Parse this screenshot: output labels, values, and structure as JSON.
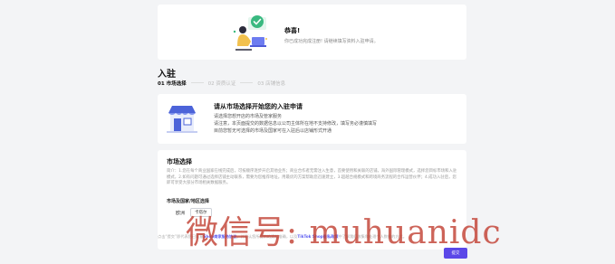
{
  "banner": {
    "title": "恭喜!",
    "subtitle": "你已成功完成注册! 请继续填写资料入驻申请。"
  },
  "page_title": "入驻",
  "steps": [
    {
      "label": "01 市场选择",
      "active": true
    },
    {
      "label": "02 资质认证",
      "active": false
    },
    {
      "label": "03 店铺信息",
      "active": false
    }
  ],
  "intro": {
    "heading": "请从市场选择开始您的入驻申请",
    "lines": [
      "请选择您想开店的市场及管家服务",
      "请注意，本页面提交的数据信息以公司主体所在地不支持修改，填写务必谨慎填写",
      "目前您暂无可选择的市场及国家可在入驻后以店铺形式开通"
    ]
  },
  "market": {
    "heading": "市场选择",
    "description": "简介：1.您在每个商业国家在线完成后，可按顺序逐步开启其他业务；商业合作者无需注入生意，首要使用和关联的店铺，海外国际管理模式，选择您目标市场和入驻模式，2.如有问题可通过选择店铺主动联系，需要为您推荐地址。用最优的方案帮助您迅速建立，3.超越合规模式和跨境商务流程的合作运营伙伴；4.成功入驻后，您即可享受大部分市场相关数据服务。",
    "section_label": "市场及国家/地区选择",
    "region_label": "欧洲",
    "region_tag": "卡塔尔",
    "footer_prefix": "点击“提交”即代表您已同意",
    "footer_link_1": "Shop商家服务协议",
    "footer_mid": "，并确认您所提供的资料准确，以及",
    "footer_link_2": "TikTok Shop隐私政策",
    "footer_suffix": "中了解我们收集和处理个人数据的方式。"
  },
  "next_button": "提交",
  "watermark": "微信号: muhuanidc",
  "colors": {
    "accent": "#5b48e8",
    "watermark": "#c0392b",
    "background": "#f3f4f6"
  }
}
